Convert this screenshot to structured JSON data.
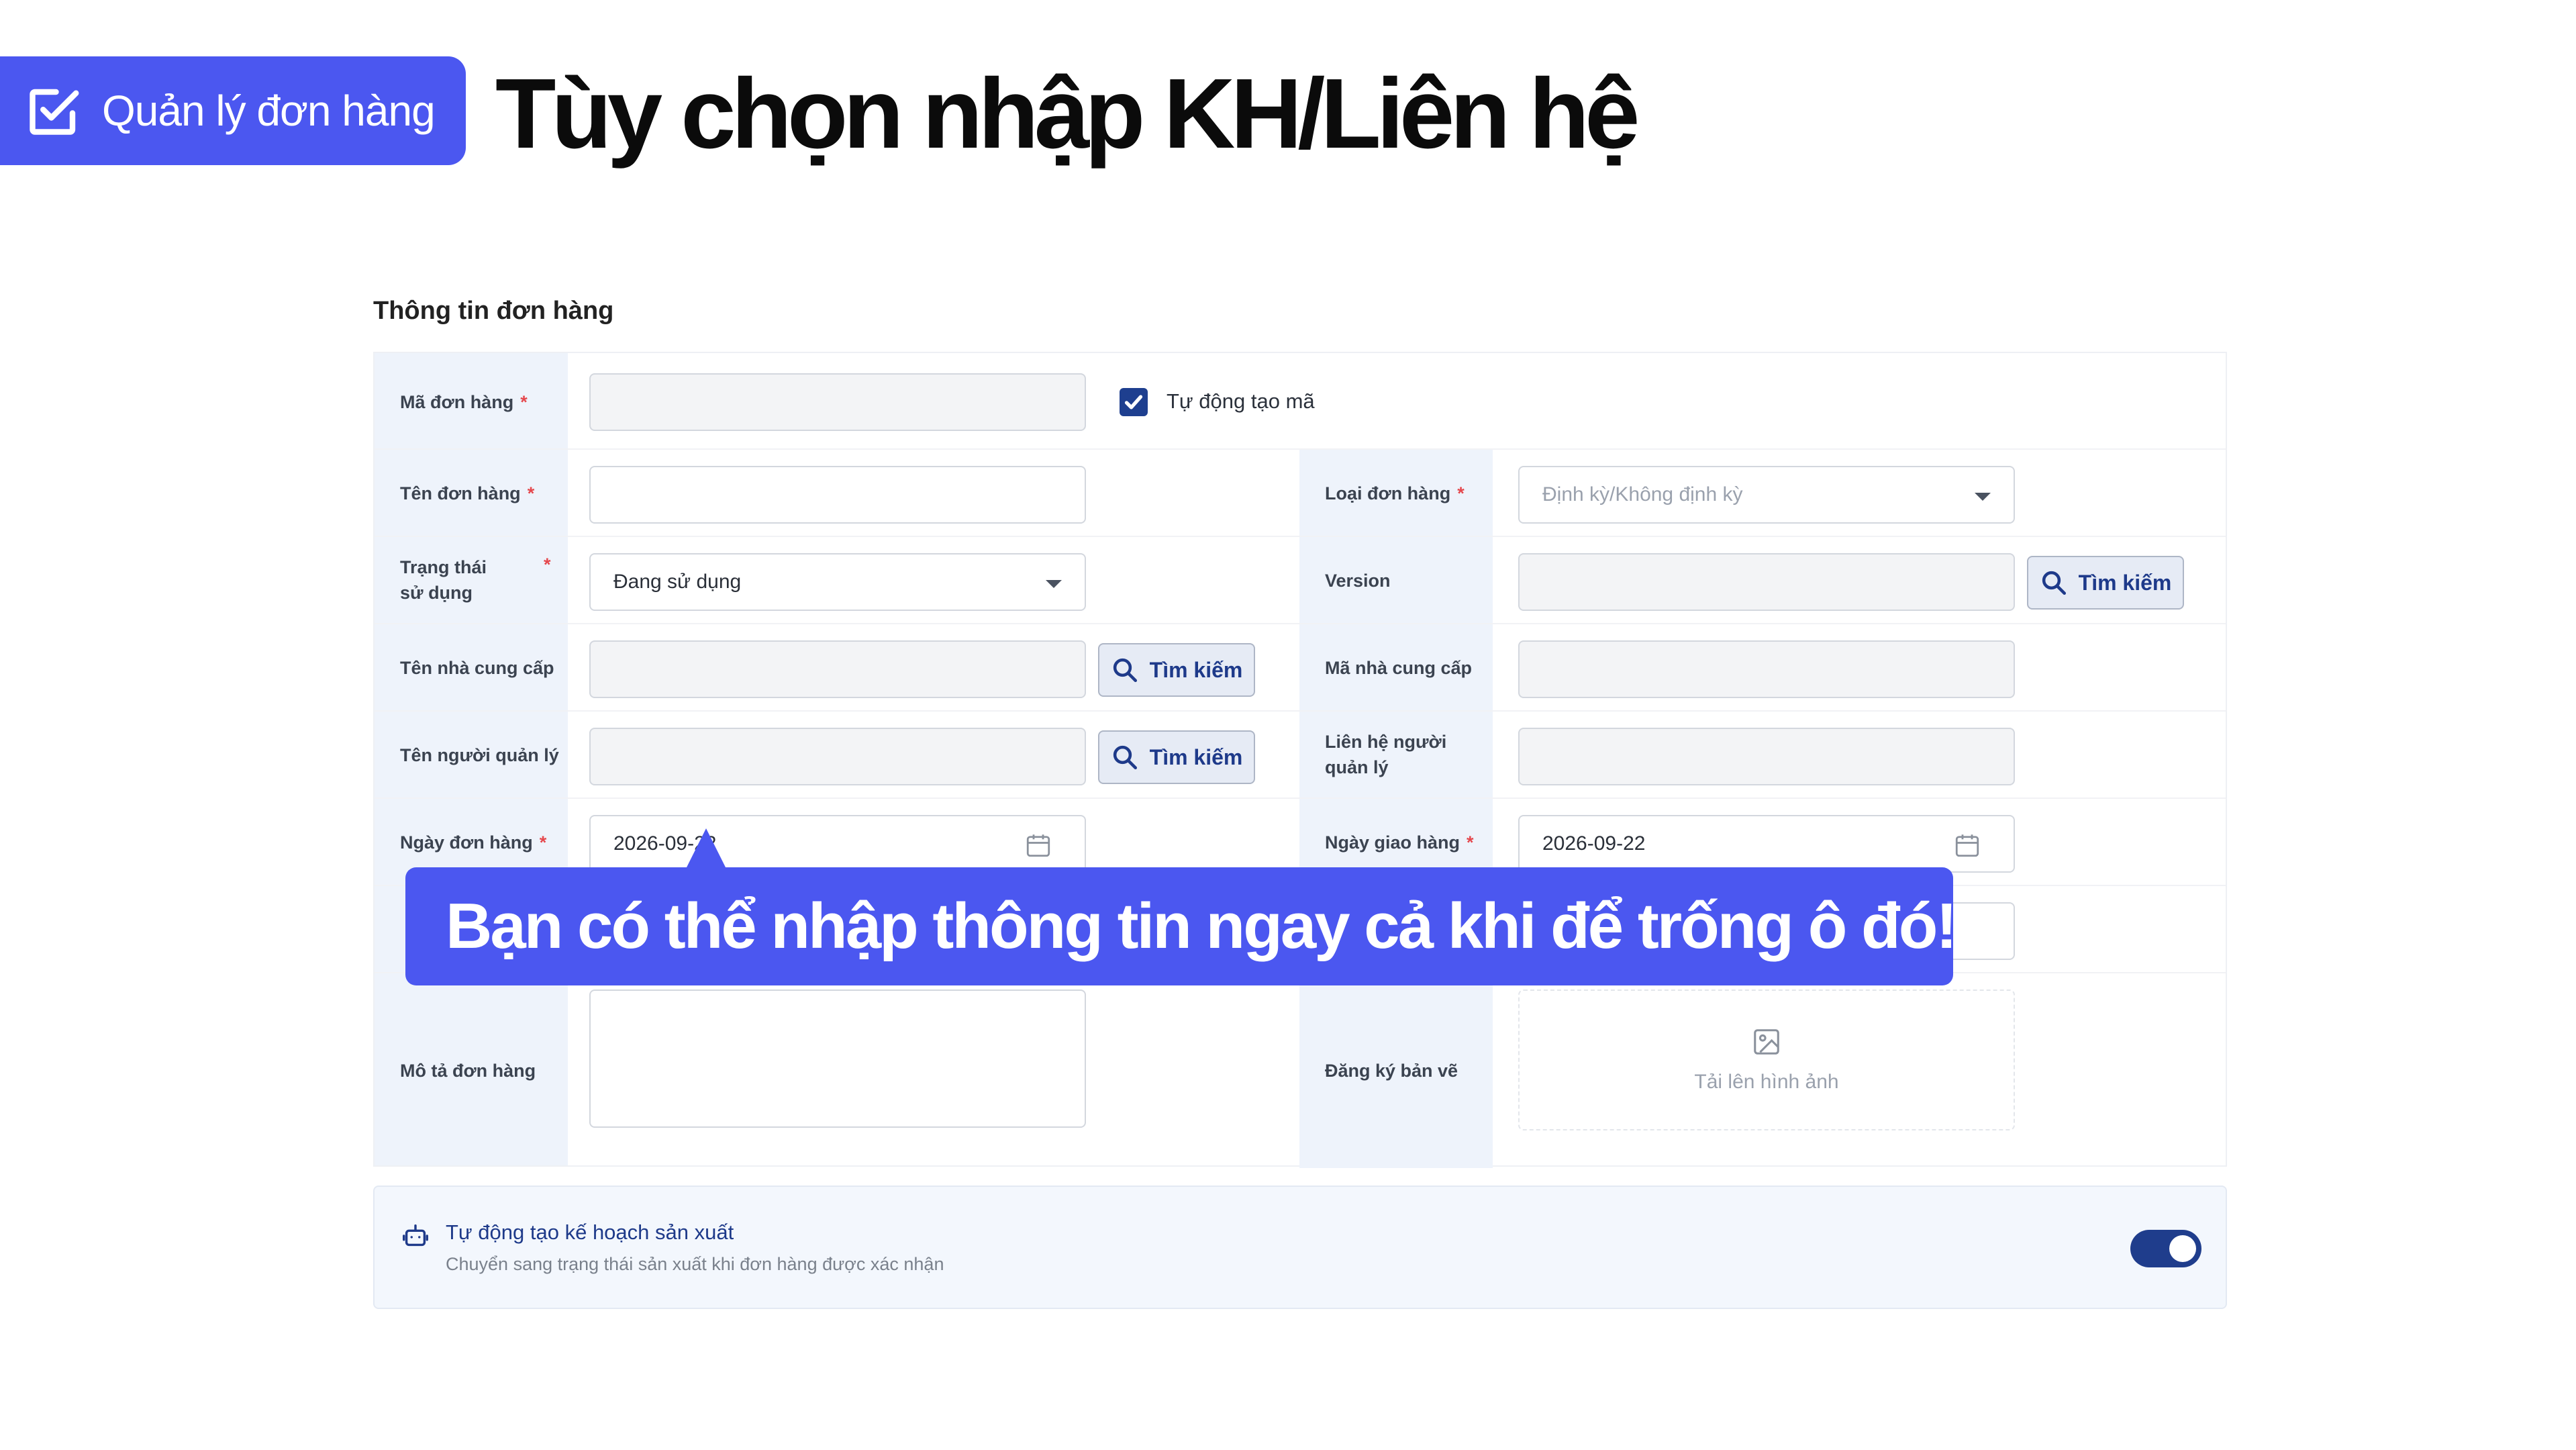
{
  "header": {
    "badge_label": "Quản lý đơn hàng",
    "badge_icon": "checkbox-edit-icon",
    "title": "Tùy chọn nhập KH/Liên hệ"
  },
  "section": {
    "title": "Thông tin đơn hàng"
  },
  "form": {
    "order_code": {
      "label": "Mã đơn hàng",
      "required": "*",
      "value": ""
    },
    "auto_code": {
      "label": "Tự động tạo mã",
      "checked": true
    },
    "order_name": {
      "label": "Tên đơn hàng",
      "required": "*",
      "value": ""
    },
    "order_type": {
      "label": "Loại đơn hàng",
      "required": "*",
      "placeholder": "Định kỳ/Không định kỳ"
    },
    "usage_status": {
      "label": "Trạng thái sử dụng",
      "required": "*",
      "value": "Đang sử dụng"
    },
    "version": {
      "label": "Version",
      "value": ""
    },
    "supplier_name": {
      "label": "Tên nhà cung cấp",
      "value": ""
    },
    "supplier_code": {
      "label": "Mã nhà cung cấp",
      "value": ""
    },
    "manager_name": {
      "label": "Tên người quản lý",
      "value": ""
    },
    "manager_contact": {
      "label": "Liên hệ người quản lý",
      "value": ""
    },
    "order_date": {
      "label": "Ngày đơn hàng",
      "required": "*",
      "value": "2026-09-22"
    },
    "delivery_date": {
      "label": "Ngày giao hàng",
      "required": "*",
      "value": "2026-09-22"
    },
    "description": {
      "label": "Mô tả đơn hàng",
      "value": ""
    },
    "drawing": {
      "label": "Đăng ký bản vẽ",
      "upload_text": "Tải lên hình ảnh"
    },
    "search_label": "Tìm kiếm"
  },
  "auto_plan": {
    "title": "Tự động tạo kế hoạch sản xuất",
    "subtitle": "Chuyển sang trạng thái sản xuất khi đơn hàng được xác nhận",
    "enabled": true
  },
  "callout": {
    "text": "Bạn có thể nhập thông tin ngay cả khi để trống ô đó!"
  },
  "colors": {
    "accent": "#4b57f0",
    "navy": "#1e3f8f",
    "required": "#e5484d",
    "label_bg": "#eef3fb"
  }
}
